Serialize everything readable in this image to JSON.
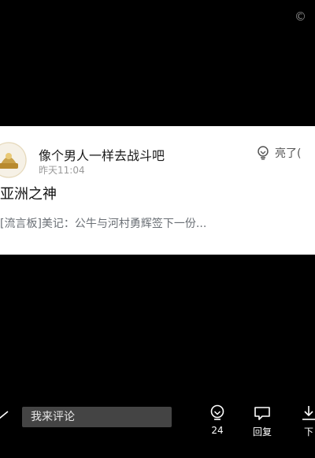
{
  "watermark": "©",
  "post": {
    "author": "像个男人一样去战斗吧",
    "time": "昨天11:04",
    "like_label": "亮了(",
    "comment": "亚洲之神",
    "quote": "[流言板]美记：公牛与河村勇辉签下一份..."
  },
  "bottom_bar": {
    "input_placeholder": "我来评论",
    "like_count": "24",
    "reply_label": "回复",
    "next_label": "下"
  },
  "colors": {
    "background": "#000000",
    "card": "#ffffff",
    "input_bg": "#444444",
    "avatar_gold": "#caa24a"
  },
  "icons": [
    "edit-icon",
    "lightbulb-icon",
    "reply-icon",
    "download-icon",
    "avatar-logo"
  ]
}
